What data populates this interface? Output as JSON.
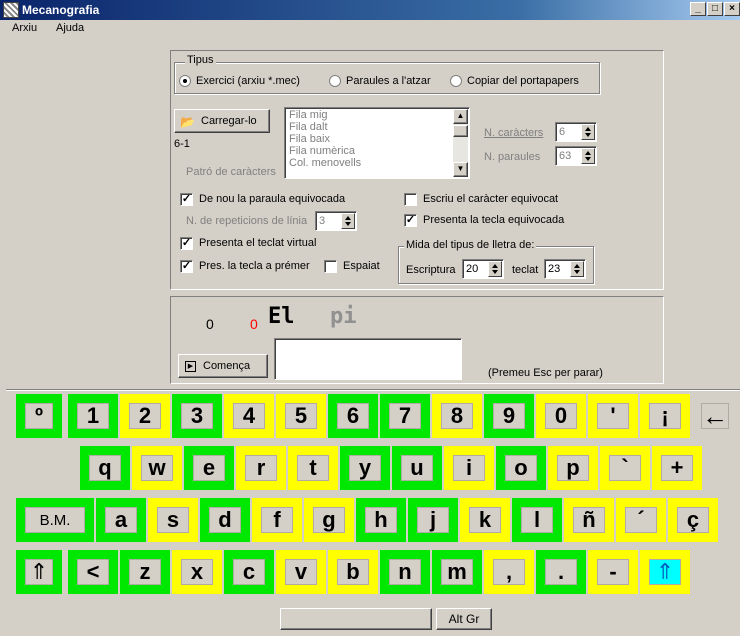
{
  "window": {
    "title": "Mecanografia",
    "min": "_",
    "max": "□",
    "close": "×"
  },
  "menu": [
    "Arxiu",
    "Ajuda"
  ],
  "tipus": {
    "label": "Tipus",
    "options": [
      "Exercici (arxiu *.mec)",
      "Paraules a l'atzar",
      "Copiar del portapapers"
    ]
  },
  "load_button": "Carregar-lo",
  "exercise_code": "6-1",
  "pattern_label": "Patró de caràcters",
  "pattern_list": [
    "Fila mig",
    "Fila dalt",
    "Fila baix",
    "Fila numèrica",
    "Col. menovells"
  ],
  "n_chars": {
    "label": "N. caràcters",
    "value": "6"
  },
  "n_words": {
    "label": "N. paraules",
    "value": "63"
  },
  "options": {
    "de_nou": "De nou la paraula equivocada",
    "escriu": "Escriu el caràcter equivocat",
    "repeticions_label": "N. de repeticions de línia",
    "repeticions_value": "3",
    "presenta_tecla": "Presenta la tecla equivocada",
    "teclat_virtual": "Presenta el teclat virtual",
    "pres_tecla": "Pres. la tecla a prémer",
    "espaiat": "Espaiat"
  },
  "font_size": {
    "label": "Mida del tipus de lletra de:",
    "escriptura_label": "Escriptura",
    "escriptura_value": "20",
    "teclat_label": "teclat",
    "teclat_value": "23"
  },
  "exercise": {
    "correct": "0",
    "errors": "0",
    "typed": "El",
    "remaining": "pi",
    "start_button": "Comença",
    "hint": "(Premeu Esc per parar)"
  },
  "keyboard": {
    "rows": [
      [
        "º",
        "1",
        "2",
        "3",
        "4",
        "5",
        "6",
        "7",
        "8",
        "9",
        "0",
        "'",
        "¡",
        "←"
      ],
      [
        "q",
        "w",
        "e",
        "r",
        "t",
        "y",
        "u",
        "i",
        "o",
        "p",
        "`",
        "+"
      ],
      [
        "B.M.",
        "a",
        "s",
        "d",
        "f",
        "g",
        "h",
        "j",
        "k",
        "l",
        "ñ",
        "´",
        "ç"
      ],
      [
        "⇑",
        "<",
        "z",
        "x",
        "c",
        "v",
        "b",
        "n",
        "m",
        ",",
        ".",
        "-",
        "⇑"
      ]
    ],
    "altgr": "Alt Gr"
  },
  "colors": {
    "green": "#00e800",
    "yellow": "#ffff00",
    "cyan": "#00ffff",
    "error_red": "#ff0000"
  }
}
